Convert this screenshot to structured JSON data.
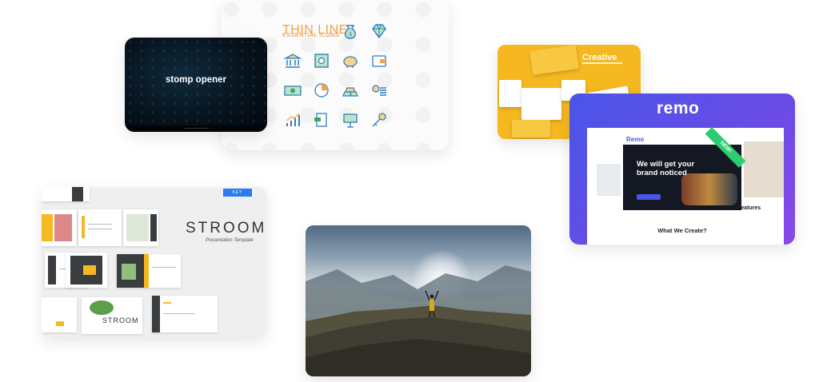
{
  "cards": {
    "stomp": {
      "title": "stomp opener"
    },
    "icons": {
      "title_line1": "THIN LINE",
      "title_line2": "ESSENTIAL ICONS"
    },
    "creative": {
      "title": "Creative"
    },
    "remo": {
      "logo": "remo",
      "brand": "Remo",
      "headline": "We will get your brand noticed",
      "section_title": "What We Create?",
      "right_label": "Features",
      "ribbon": "NEW!"
    },
    "stroom": {
      "badge": "KEY",
      "title": "STROOM",
      "subtitle": "Presentation Template",
      "mini_logo": "STROOM"
    },
    "photo": {}
  },
  "icon_names": [
    "money-bag-icon",
    "diamond-icon",
    "bank-icon",
    "safe-icon",
    "piggy-bank-icon",
    "wallet-icon",
    "banknote-icon",
    "pie-chart-icon",
    "gold-bars-icon",
    "coins-icon",
    "growth-chart-icon",
    "receipt-icon",
    "presentation-board-icon",
    "key-icon"
  ],
  "colors": {
    "icons_accent": "#f2a24a",
    "icons_blue": "#2d7fbf",
    "icons_green": "#3ca86b",
    "creative_yellow": "#f6b820",
    "remo_purple": "#5b50e8",
    "stroom_badge": "#2b7cf0"
  }
}
